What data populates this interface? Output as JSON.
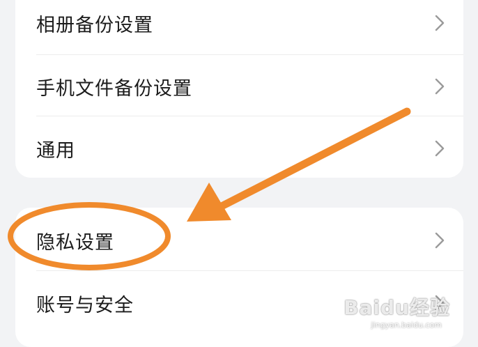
{
  "settings": {
    "group1": [
      {
        "label": "相册备份设置",
        "icon": "chevron-right-icon"
      },
      {
        "label": "手机文件备份设置",
        "icon": "chevron-right-icon"
      },
      {
        "label": "通用",
        "icon": "chevron-right-icon"
      }
    ],
    "group2": [
      {
        "label": "隐私设置",
        "icon": "chevron-right-icon"
      },
      {
        "label": "账号与安全",
        "icon": "chevron-right-icon"
      }
    ]
  },
  "annotation": {
    "color": "#f08a2c",
    "target": "隐私设置"
  },
  "watermark": {
    "brand": "Baidu经验",
    "site": "jingyan.baidu.com"
  }
}
